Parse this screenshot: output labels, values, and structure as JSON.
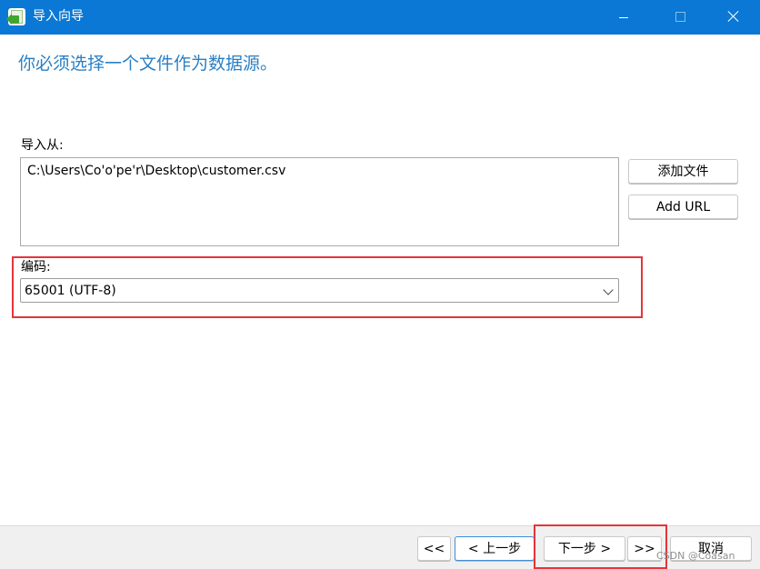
{
  "window": {
    "title": "导入向导",
    "controls": {
      "minimize": "minimize",
      "maximize": "maximize",
      "close": "close"
    }
  },
  "page": {
    "heading": "你必须选择一个文件作为数据源。",
    "import_from_label": "导入从:",
    "import_path": "C:\\Users\\Co'o'pe'r\\Desktop\\customer.csv",
    "add_file_label": "添加文件",
    "add_url_label": "Add URL",
    "encoding_label": "编码:",
    "encoding_value": "65001 (UTF-8)"
  },
  "footer": {
    "first_label": "<<",
    "back_label": "< 上一步",
    "next_label": "下一步 >",
    "last_label": ">>",
    "cancel_label": "取消"
  },
  "watermark": "CSDN @Coasan",
  "colors": {
    "titlebar": "#0a78d4",
    "heading": "#2a7fc4",
    "annotation": "#e5343a",
    "primary_border": "#3c8fd8"
  },
  "icons": {
    "app": "import-wizard-icon",
    "dropdown": "chevron-down-icon"
  }
}
